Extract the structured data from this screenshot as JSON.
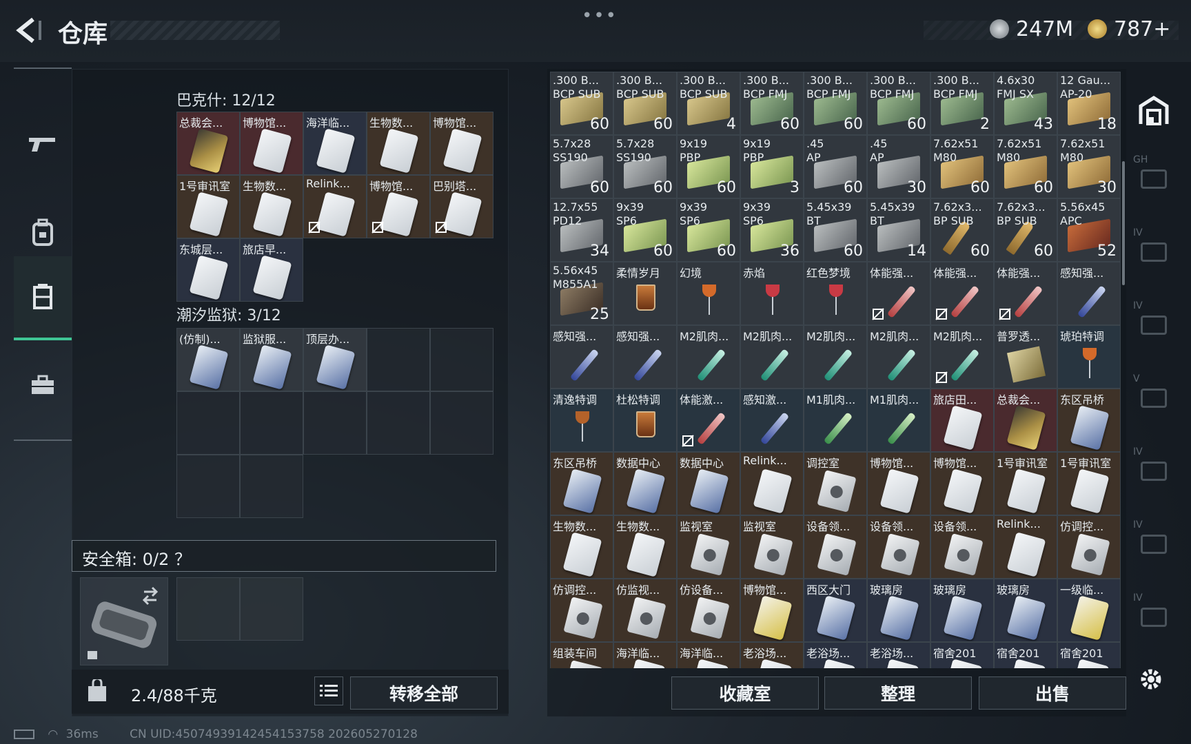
{
  "header": {
    "title": "仓库",
    "currency1": "247M",
    "currency2": "787+"
  },
  "left_panel": {
    "section1": {
      "label": "巴克什: 12/12",
      "items": [
        {
          "name": "总裁会...",
          "icon": "card-gold",
          "bg": "rd"
        },
        {
          "name": "博物馆...",
          "icon": "card",
          "bg": "rd"
        },
        {
          "name": "海洋临...",
          "icon": "card",
          "bg": "bl"
        },
        {
          "name": "生物数...",
          "icon": "card",
          "bg": "br"
        },
        {
          "name": "博物馆...",
          "icon": "card",
          "bg": "br"
        },
        {
          "name": "1号审讯室",
          "icon": "card",
          "bg": "br"
        },
        {
          "name": "生物数...",
          "icon": "card",
          "bg": "br"
        },
        {
          "name": "Relink...",
          "icon": "card",
          "bg": "br",
          "nf": true
        },
        {
          "name": "博物馆...",
          "icon": "card",
          "bg": "br",
          "nf": true
        },
        {
          "name": "巴别塔...",
          "icon": "card",
          "bg": "br",
          "nf": true
        },
        {
          "name": "东城层...",
          "icon": "card",
          "bg": "bl"
        },
        {
          "name": "旅店早...",
          "icon": "card",
          "bg": "bl"
        }
      ]
    },
    "section2": {
      "label": "潮汐监狱: 3/12",
      "items": [
        {
          "name": "(仿制)...",
          "icon": "card-navy",
          "bg": "gy"
        },
        {
          "name": "监狱服...",
          "icon": "card-navy",
          "bg": "gy"
        },
        {
          "name": "顶层办...",
          "icon": "card-navy",
          "bg": "gy"
        }
      ]
    },
    "safe_label": "安全箱: 0/2 ？",
    "weight": "2.4/88千克",
    "transfer_all": "转移全部"
  },
  "right_panel": {
    "items": [
      {
        "name": ".300 B...",
        "name2": "BCP SUB",
        "qty": "60",
        "icon": "ammo a-gold",
        "bg": "gy"
      },
      {
        "name": ".300 B...",
        "name2": "BCP SUB",
        "qty": "60",
        "icon": "ammo a-gold",
        "bg": "gy"
      },
      {
        "name": ".300 B...",
        "name2": "BCP SUB",
        "qty": "4",
        "icon": "ammo a-gold",
        "bg": "gy"
      },
      {
        "name": ".300 B...",
        "name2": "BCP FMJ",
        "qty": "60",
        "icon": "ammo a-green",
        "bg": "gy"
      },
      {
        "name": ".300 B...",
        "name2": "BCP FMJ",
        "qty": "60",
        "icon": "ammo a-green",
        "bg": "gy"
      },
      {
        "name": ".300 B...",
        "name2": "BCP FMJ",
        "qty": "60",
        "icon": "ammo a-green",
        "bg": "gy"
      },
      {
        "name": ".300 B...",
        "name2": "BCP FMJ",
        "qty": "2",
        "icon": "ammo a-green",
        "bg": "gy"
      },
      {
        "name": "4.6x30",
        "name2": "FMJ SX",
        "qty": "43",
        "icon": "ammo a-green",
        "bg": "gy"
      },
      {
        "name": "12 Gau...",
        "name2": "AP-20",
        "qty": "18",
        "icon": "ammo a-wood",
        "bg": "gy"
      },
      {
        "name": "5.7x28",
        "name2": "SS190",
        "qty": "60",
        "icon": "ammo a-grey",
        "bg": "gy"
      },
      {
        "name": "5.7x28",
        "name2": "SS190",
        "qty": "60",
        "icon": "ammo a-grey",
        "bg": "gy"
      },
      {
        "name": "9x19",
        "name2": "PBP",
        "qty": "60",
        "icon": "ammo a-lime",
        "bg": "gy"
      },
      {
        "name": "9x19",
        "name2": "PBP",
        "qty": "3",
        "icon": "ammo a-lime",
        "bg": "gy"
      },
      {
        "name": ".45",
        "name2": "AP",
        "qty": "60",
        "icon": "ammo a-grey",
        "bg": "gy"
      },
      {
        "name": ".45",
        "name2": "AP",
        "qty": "30",
        "icon": "ammo a-grey",
        "bg": "gy"
      },
      {
        "name": "7.62x51",
        "name2": "M80",
        "qty": "60",
        "icon": "ammo a-wood",
        "bg": "gy"
      },
      {
        "name": "7.62x51",
        "name2": "M80",
        "qty": "60",
        "icon": "ammo a-wood",
        "bg": "gy"
      },
      {
        "name": "7.62x51",
        "name2": "M80",
        "qty": "30",
        "icon": "ammo a-wood",
        "bg": "gy"
      },
      {
        "name": "12.7x55",
        "name2": "PD12",
        "qty": "34",
        "icon": "ammo a-grey",
        "bg": "gy"
      },
      {
        "name": "9x39",
        "name2": "SP6",
        "qty": "60",
        "icon": "ammo a-lime",
        "bg": "gy"
      },
      {
        "name": "9x39",
        "name2": "SP6",
        "qty": "60",
        "icon": "ammo a-lime",
        "bg": "gy"
      },
      {
        "name": "9x39",
        "name2": "SP6",
        "qty": "36",
        "icon": "ammo a-lime",
        "bg": "gy"
      },
      {
        "name": "5.45x39",
        "name2": "BT",
        "qty": "60",
        "icon": "ammo a-grey",
        "bg": "gy"
      },
      {
        "name": "5.45x39",
        "name2": "BT",
        "qty": "14",
        "icon": "ammo a-grey",
        "bg": "gy"
      },
      {
        "name": "7.62x3...",
        "name2": "BP SUB",
        "qty": "60",
        "icon": "a-bullet",
        "bg": "gy"
      },
      {
        "name": "7.62x3...",
        "name2": "BP SUB",
        "qty": "60",
        "icon": "a-bullet",
        "bg": "gy"
      },
      {
        "name": "5.56x45",
        "name2": "APC",
        "qty": "52",
        "icon": "ammo a-red",
        "bg": "gy"
      },
      {
        "name": "5.56x45",
        "name2": "M855A1",
        "qty": "25",
        "icon": "ammo a-dk",
        "bg": "gy"
      },
      {
        "name": "柔情岁月",
        "icon": "tumbler",
        "bg": "gy"
      },
      {
        "name": "幻境",
        "icon": "glass-orange",
        "bg": "gy"
      },
      {
        "name": "赤焰",
        "icon": "glass-red",
        "bg": "gy"
      },
      {
        "name": "红色梦境",
        "icon": "glass-red",
        "bg": "gy"
      },
      {
        "name": "体能强...",
        "icon": "inj in-red",
        "bg": "gy",
        "nf": true
      },
      {
        "name": "体能强...",
        "icon": "inj in-red",
        "bg": "gy",
        "nf": true
      },
      {
        "name": "体能强...",
        "icon": "inj in-red",
        "bg": "gy",
        "nf": true
      },
      {
        "name": "感知强...",
        "icon": "inj in-blue",
        "bg": "gy"
      },
      {
        "name": "感知强...",
        "icon": "inj in-blue",
        "bg": "gy"
      },
      {
        "name": "感知强...",
        "icon": "inj in-blue",
        "bg": "gy"
      },
      {
        "name": "M2肌肉...",
        "icon": "inj in-teal",
        "bg": "gy"
      },
      {
        "name": "M2肌肉...",
        "icon": "inj in-teal",
        "bg": "gy"
      },
      {
        "name": "M2肌肉...",
        "icon": "inj in-teal",
        "bg": "gy"
      },
      {
        "name": "M2肌肉...",
        "icon": "inj in-teal",
        "bg": "gy"
      },
      {
        "name": "M2肌肉...",
        "icon": "inj in-teal",
        "bg": "gy",
        "nf": true
      },
      {
        "name": "普罗透...",
        "icon": "pkg",
        "bg": "gy"
      },
      {
        "name": "琥珀特调",
        "icon": "glass-orange",
        "bg": "tl"
      },
      {
        "name": "清逸特调",
        "icon": "glass-amber",
        "bg": "tl"
      },
      {
        "name": "杜松特调",
        "icon": "tumbler",
        "bg": "tl"
      },
      {
        "name": "体能激...",
        "icon": "inj in-red",
        "bg": "tl",
        "nf": true
      },
      {
        "name": "感知激...",
        "icon": "inj in-blue",
        "bg": "tl"
      },
      {
        "name": "M1肌肉...",
        "icon": "inj in-green",
        "bg": "tl"
      },
      {
        "name": "M1肌肉...",
        "icon": "inj in-green",
        "bg": "tl"
      },
      {
        "name": "旅店田...",
        "icon": "card",
        "bg": "rd"
      },
      {
        "name": "总裁会...",
        "icon": "card-gold",
        "bg": "rd"
      },
      {
        "name": "东区吊桥",
        "icon": "card-navy",
        "bg": "br"
      },
      {
        "name": "东区吊桥",
        "icon": "card-navy",
        "bg": "br"
      },
      {
        "name": "数据中心",
        "icon": "card-navy",
        "bg": "br"
      },
      {
        "name": "数据中心",
        "icon": "card-navy",
        "bg": "br"
      },
      {
        "name": "Relink...",
        "icon": "card",
        "bg": "br"
      },
      {
        "name": "调控室",
        "icon": "relic",
        "bg": "br"
      },
      {
        "name": "博物馆...",
        "icon": "card",
        "bg": "br"
      },
      {
        "name": "博物馆...",
        "icon": "card",
        "bg": "br"
      },
      {
        "name": "1号审讯室",
        "icon": "card",
        "bg": "br"
      },
      {
        "name": "1号审讯室",
        "icon": "card",
        "bg": "br"
      },
      {
        "name": "生物数...",
        "icon": "card",
        "bg": "br"
      },
      {
        "name": "生物数...",
        "icon": "card",
        "bg": "br"
      },
      {
        "name": "监视室",
        "icon": "relic",
        "bg": "br"
      },
      {
        "name": "监视室",
        "icon": "relic",
        "bg": "br"
      },
      {
        "name": "设备领...",
        "icon": "relic",
        "bg": "br"
      },
      {
        "name": "设备领...",
        "icon": "relic",
        "bg": "br"
      },
      {
        "name": "设备领...",
        "icon": "relic",
        "bg": "br"
      },
      {
        "name": "Relink...",
        "icon": "card",
        "bg": "br"
      },
      {
        "name": "仿调控...",
        "icon": "relic",
        "bg": "br"
      },
      {
        "name": "仿调控...",
        "icon": "relic",
        "bg": "br"
      },
      {
        "name": "仿监视...",
        "icon": "relic",
        "bg": "br"
      },
      {
        "name": "仿设备...",
        "icon": "relic",
        "bg": "br"
      },
      {
        "name": "博物馆...",
        "icon": "card-yel",
        "bg": "br"
      },
      {
        "name": "西区大门",
        "icon": "card-navy",
        "bg": "bl"
      },
      {
        "name": "玻璃房",
        "icon": "card-navy",
        "bg": "bl"
      },
      {
        "name": "玻璃房",
        "icon": "card-navy",
        "bg": "bl"
      },
      {
        "name": "玻璃房",
        "icon": "card-navy",
        "bg": "bl"
      },
      {
        "name": "一级临...",
        "icon": "card-yel",
        "bg": "bl"
      },
      {
        "name": "组装车间",
        "icon": "relic",
        "bg": "br"
      },
      {
        "name": "海洋临...",
        "icon": "card",
        "bg": "br"
      },
      {
        "name": "海洋临...",
        "icon": "card",
        "bg": "br"
      },
      {
        "name": "老浴场...",
        "icon": "card",
        "bg": "br"
      },
      {
        "name": "老浴场...",
        "icon": "card",
        "bg": "bl"
      },
      {
        "name": "老浴场...",
        "icon": "card",
        "bg": "bl"
      },
      {
        "name": "宿舍201",
        "icon": "card",
        "bg": "bl"
      },
      {
        "name": "宿舍201",
        "icon": "card",
        "bg": "bl"
      },
      {
        "name": "宿舍201",
        "icon": "card",
        "bg": "bl"
      }
    ],
    "buttons": {
      "collection": "收藏室",
      "sort": "整理",
      "sell": "出售"
    }
  },
  "right_sidebar": {
    "labels": [
      "GH",
      "IV",
      "IV",
      "V",
      "IV",
      "IV",
      "IV"
    ]
  },
  "status": {
    "ping": "36ms",
    "uid": "CN UID:4507493914245415375​8 202605270128"
  },
  "colors": {
    "accent": "#3fc695"
  }
}
